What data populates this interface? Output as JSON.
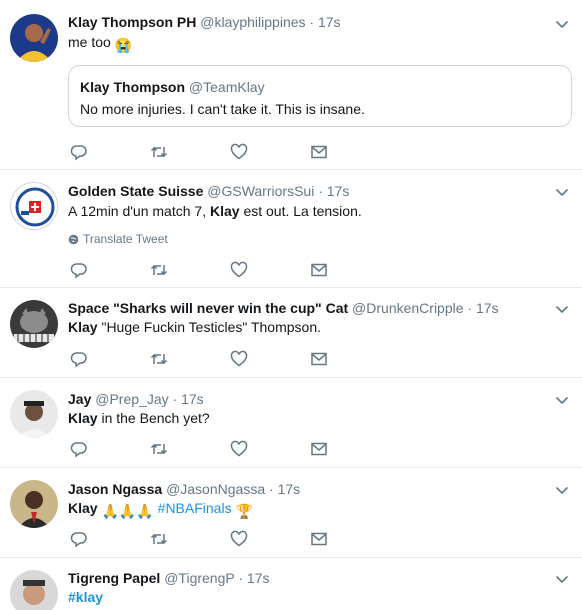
{
  "tweets": [
    {
      "name": "Klay Thompson PH",
      "handle": "@klayphilippines",
      "time": "17s",
      "text": "me too",
      "emoji": "😭",
      "quote": {
        "name": "Klay Thompson",
        "handle": "@TeamKlay",
        "text": "No more injuries. I can't take it. This is insane."
      }
    },
    {
      "name": "Golden State Suisse",
      "handle": "@GSWarriorsSui",
      "time": "17s",
      "text_pre": "A 12min d'un match 7, ",
      "text_bold": "Klay",
      "text_post": " est out. La tension.",
      "translate": "Translate Tweet"
    },
    {
      "name": "Space \"Sharks will never win the cup\" Cat",
      "handle": "@DrunkenCripple",
      "time": "17s",
      "text_bold": "Klay",
      "text_post": " \"Huge Fuckin Testicles\" Thompson."
    },
    {
      "name": "Jay",
      "handle": "@Prep_Jay",
      "time": "17s",
      "text_bold": "Klay",
      "text_post": " in the Bench yet?"
    },
    {
      "name": "Jason Ngassa",
      "handle": "@JasonNgassa",
      "time": "17s",
      "text_bold": "Klay",
      "emojis": "🙏🙏🙏",
      "hashtag": "#NBAFinals",
      "trophy": "🏆"
    },
    {
      "name": "Tigreng Papel",
      "handle": "@TigrengP",
      "time": "17s",
      "hashtag": "#klay"
    }
  ],
  "dot": "·",
  "colors": {
    "text": "#14171a",
    "secondary": "#657786",
    "link": "#1b95e0",
    "border": "#e6ecf0"
  },
  "icons": [
    "reply-icon",
    "retweet-icon",
    "like-icon",
    "message-icon",
    "chevron-down-icon",
    "globe-icon"
  ]
}
